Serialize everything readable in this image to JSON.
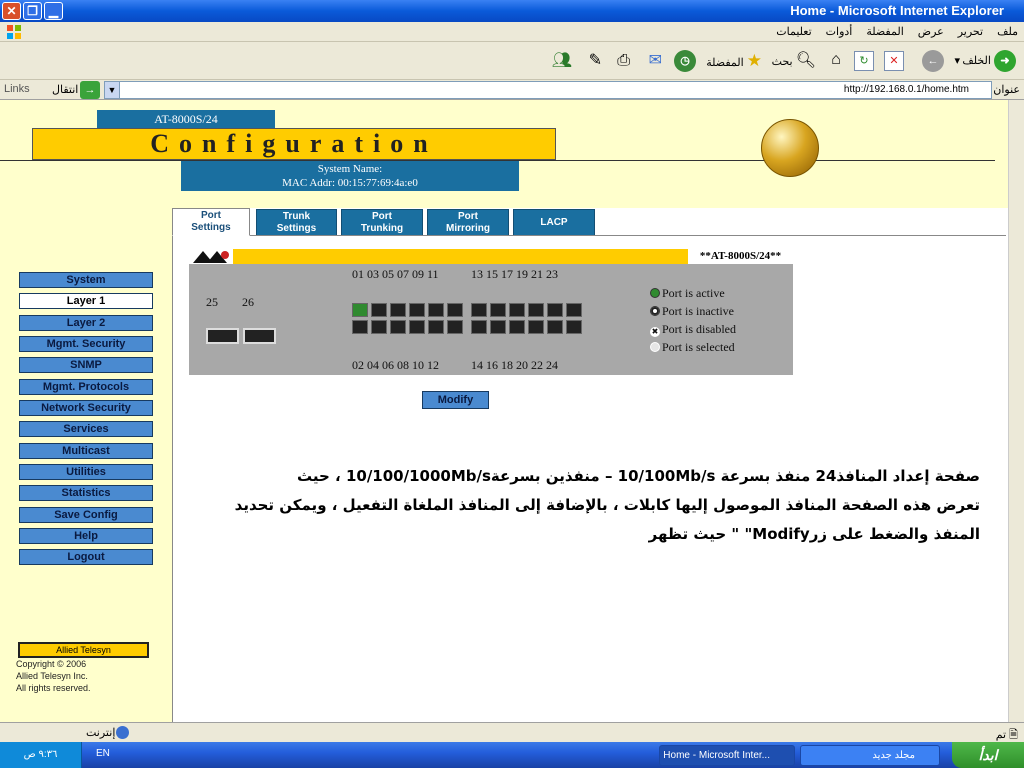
{
  "window": {
    "title": "Home - Microsoft Internet Explorer"
  },
  "menu": {
    "items": [
      "ملف",
      "تحرير",
      "عرض",
      "المفضلة",
      "أدوات",
      "تعليمات"
    ]
  },
  "toolbar": {
    "back_label": "الخلف",
    "search_label": "بحث",
    "favorites_label": "المفضلة"
  },
  "address": {
    "label": "عنوان",
    "url": "http://192.168.0.1/home.htm",
    "go_label": "انتقال",
    "links_label": "Links"
  },
  "header": {
    "model": "AT-8000S/24",
    "banner": "Configuration",
    "system_name_label": "System Name:",
    "mac_label": "MAC Addr:  00:15:77:69:4a:e0"
  },
  "tabs": [
    {
      "line1": "Port",
      "line2": "Settings"
    },
    {
      "line1": "Trunk",
      "line2": "Settings"
    },
    {
      "line1": "Port",
      "line2": "Trunking"
    },
    {
      "line1": "Port",
      "line2": "Mirroring"
    },
    {
      "line1": "LACP",
      "line2": ""
    }
  ],
  "nav": [
    "System",
    "Layer 1",
    "Layer 2",
    "Mgmt. Security",
    "SNMP",
    "Mgmt. Protocols",
    "Network Security",
    "Services",
    "Multicast",
    "Utilities",
    "Statistics",
    "Save Config",
    "Help",
    "Logout"
  ],
  "switch": {
    "model": "**AT-8000S/24**",
    "top_ports_a": "01 03 05 07 09 11",
    "top_ports_b": "13 15 17 19 21 23",
    "bottom_ports_a": "02 04 06 08 10 12",
    "bottom_ports_b": "14 16 18 20 22 24",
    "sfp_25": "25",
    "sfp_26": "26",
    "active_ports": [
      "01"
    ],
    "legend": {
      "active": "Port is active",
      "inactive": "Port is inactive",
      "disabled": "Port is disabled",
      "selected": "Port is selected"
    },
    "colors": {
      "active": "#2f8a2f",
      "inactive": "#222222",
      "panel": "#a8a8a8"
    }
  },
  "modify_label": "Modify",
  "description": {
    "line1": "صفحة إعداد المنافذ24 منفذ بسرعة 10/100Mb/s – منفذين بسرعة10/100/1000Mb/s ، حيث",
    "line2": "تعرض هذه الصفحة المنافذ الموصول إليها كابلات ، بالإضافة إلى المنافذ الملغاة التفعيل ، ويمكن تحديد",
    "line3": "المنفذ والضغط على زرModify\" \" حيث تظهر"
  },
  "brand": {
    "name": "Allied Telesyn",
    "copyright1": "Copyright © 2006",
    "copyright2": "Allied Telesyn Inc.",
    "copyright3": "All rights reserved."
  },
  "status": {
    "done": "تم",
    "zone": "إنترنت"
  },
  "taskbar": {
    "start": "ابدأ",
    "task1": "Home - Microsoft Inter...",
    "task2": "مجلد جديد",
    "clock": "٩:٣٦ ص",
    "lang": "EN"
  },
  "accent_colors": {
    "nav_blue": "#4a8ad0",
    "header_blue": "#1a6fa0",
    "banner_yellow": "#ffcc00",
    "panel_bg": "#ffffcc"
  }
}
